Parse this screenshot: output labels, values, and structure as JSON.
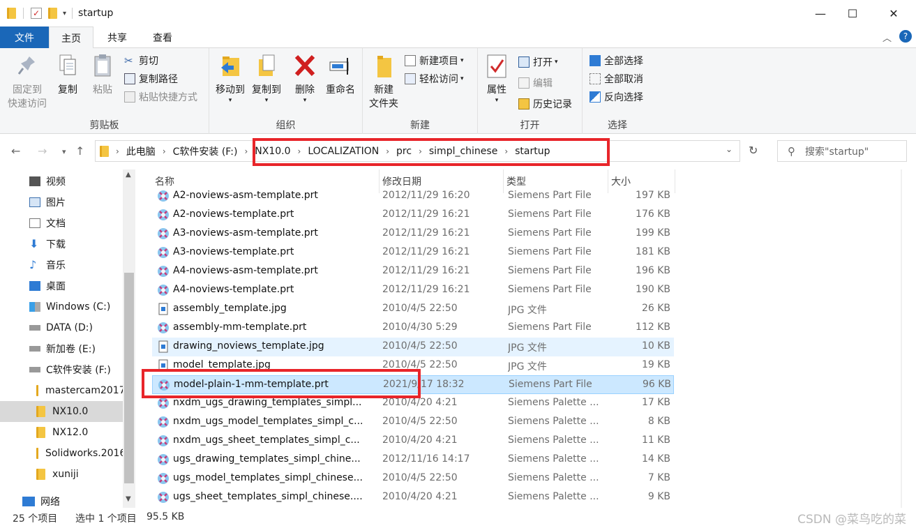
{
  "window": {
    "title": "startup"
  },
  "tabs": {
    "file": "文件",
    "home": "主页",
    "share": "共享",
    "view": "查看"
  },
  "ribbon": {
    "clipboard": {
      "label": "剪贴板",
      "pin_line1": "固定到",
      "pin_line2": "快速访问",
      "copy": "复制",
      "paste": "粘贴",
      "cut": "剪切",
      "copy_path": "复制路径",
      "paste_shortcut": "粘贴快捷方式"
    },
    "organize": {
      "label": "组织",
      "move_to": "移动到",
      "copy_to": "复制到",
      "delete": "删除",
      "rename": "重命名"
    },
    "new": {
      "label": "新建",
      "new_folder_line1": "新建",
      "new_folder_line2": "文件夹",
      "new_item": "新建项目",
      "easy_access": "轻松访问"
    },
    "open": {
      "label": "打开",
      "properties": "属性",
      "open": "打开",
      "edit": "编辑",
      "history": "历史记录"
    },
    "select": {
      "label": "选择",
      "select_all": "全部选择",
      "select_none": "全部取消",
      "invert": "反向选择"
    }
  },
  "address": {
    "crumbs": [
      "此电脑",
      "C软件安装 (F:)",
      "NX10.0",
      "LOCALIZATION",
      "prc",
      "simpl_chinese",
      "startup"
    ],
    "search_placeholder": "搜索\"startup\""
  },
  "nav": {
    "items": [
      "视频",
      "图片",
      "文档",
      "下载",
      "音乐",
      "桌面",
      "Windows (C:)",
      "DATA (D:)",
      "新加卷 (E:)",
      "C软件安装 (F:)",
      "mastercam2017",
      "NX10.0",
      "NX12.0",
      "Solidworks.2016",
      "xuniji",
      "网络"
    ]
  },
  "columns": {
    "name": "名称",
    "date": "修改日期",
    "type": "类型",
    "size": "大小"
  },
  "files": [
    {
      "name": "A2-noviews-asm-template.prt",
      "date": "2012/11/29 16:20",
      "type": "Siemens Part File",
      "size": "197 KB"
    },
    {
      "name": "A2-noviews-template.prt",
      "date": "2012/11/29 16:21",
      "type": "Siemens Part File",
      "size": "176 KB"
    },
    {
      "name": "A3-noviews-asm-template.prt",
      "date": "2012/11/29 16:21",
      "type": "Siemens Part File",
      "size": "199 KB"
    },
    {
      "name": "A3-noviews-template.prt",
      "date": "2012/11/29 16:21",
      "type": "Siemens Part File",
      "size": "181 KB"
    },
    {
      "name": "A4-noviews-asm-template.prt",
      "date": "2012/11/29 16:21",
      "type": "Siemens Part File",
      "size": "196 KB"
    },
    {
      "name": "A4-noviews-template.prt",
      "date": "2012/11/29 16:21",
      "type": "Siemens Part File",
      "size": "190 KB"
    },
    {
      "name": "assembly_template.jpg",
      "date": "2010/4/5 22:50",
      "type": "JPG 文件",
      "size": "26 KB"
    },
    {
      "name": "assembly-mm-template.prt",
      "date": "2010/4/30 5:29",
      "type": "Siemens Part File",
      "size": "112 KB"
    },
    {
      "name": "drawing_noviews_template.jpg",
      "date": "2010/4/5 22:50",
      "type": "JPG 文件",
      "size": "10 KB"
    },
    {
      "name": "model_template.jpg",
      "date": "2010/4/5 22:50",
      "type": "JPG 文件",
      "size": "19 KB"
    },
    {
      "name": "model-plain-1-mm-template.prt",
      "date": "2021/9/17 18:32",
      "type": "Siemens Part File",
      "size": "96 KB"
    },
    {
      "name": "nxdm_ugs_drawing_templates_simpl...",
      "date": "2010/4/20 4:21",
      "type": "Siemens Palette ...",
      "size": "17 KB"
    },
    {
      "name": "nxdm_ugs_model_templates_simpl_c...",
      "date": "2010/4/5 22:50",
      "type": "Siemens Palette ...",
      "size": "8 KB"
    },
    {
      "name": "nxdm_ugs_sheet_templates_simpl_c...",
      "date": "2010/4/20 4:21",
      "type": "Siemens Palette ...",
      "size": "11 KB"
    },
    {
      "name": "ugs_drawing_templates_simpl_chine...",
      "date": "2012/11/16 14:17",
      "type": "Siemens Palette ...",
      "size": "14 KB"
    },
    {
      "name": "ugs_model_templates_simpl_chinese...",
      "date": "2010/4/5 22:50",
      "type": "Siemens Palette ...",
      "size": "7 KB"
    },
    {
      "name": "ugs_sheet_templates_simpl_chinese....",
      "date": "2010/4/20 4:21",
      "type": "Siemens Palette ...",
      "size": "9 KB"
    }
  ],
  "status": {
    "count": "25 个项目",
    "selected": "选中 1 个项目",
    "size": "95.5 KB",
    "watermark": "CSDN @菜鸟吃的菜"
  },
  "colors": {
    "accent": "#1a67b8",
    "highlight": "#e8252a",
    "selected_row": "#cce8ff"
  }
}
